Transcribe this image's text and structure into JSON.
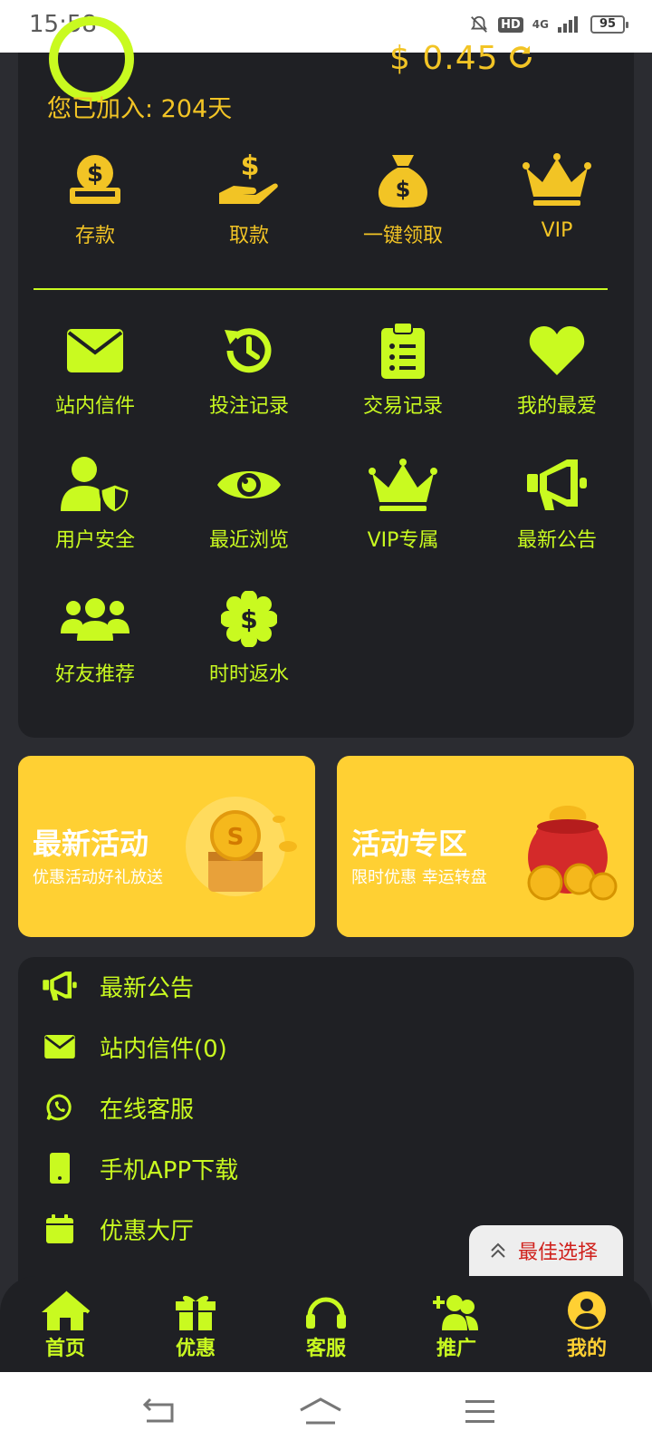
{
  "status_bar": {
    "time": "15:58",
    "hd": "HD",
    "network": "4G",
    "battery": "95"
  },
  "account": {
    "balance": "$ 0.45",
    "joined_text": "您已加入: 204天"
  },
  "quick_actions": [
    {
      "label": "存款",
      "icon": "deposit-icon"
    },
    {
      "label": "取款",
      "icon": "withdraw-icon"
    },
    {
      "label": "一键领取",
      "icon": "money-bag-icon"
    },
    {
      "label": "VIP",
      "icon": "crown-icon"
    }
  ],
  "features": [
    {
      "label": "站内信件",
      "icon": "mail-icon"
    },
    {
      "label": "投注记录",
      "icon": "history-icon"
    },
    {
      "label": "交易记录",
      "icon": "clipboard-icon"
    },
    {
      "label": "我的最爱",
      "icon": "heart-icon"
    },
    {
      "label": "用户安全",
      "icon": "user-shield-icon"
    },
    {
      "label": "最近浏览",
      "icon": "eye-icon"
    },
    {
      "label": "VIP专属",
      "icon": "crown-icon"
    },
    {
      "label": "最新公告",
      "icon": "megaphone-icon"
    },
    {
      "label": "好友推荐",
      "icon": "users-icon"
    },
    {
      "label": "时时返水",
      "icon": "rebate-icon"
    }
  ],
  "promos": [
    {
      "title": "最新活动",
      "subtitle": "优惠活动好礼放送"
    },
    {
      "title": "活动专区",
      "subtitle": "限时优惠 幸运转盘"
    }
  ],
  "menu": [
    {
      "label": "最新公告",
      "icon": "megaphone-icon"
    },
    {
      "label": "站内信件(0)",
      "icon": "mail-icon"
    },
    {
      "label": "在线客服",
      "icon": "whatsapp-icon"
    },
    {
      "label": "手机APP下载",
      "icon": "phone-icon"
    },
    {
      "label": "优惠大厅",
      "icon": "calendar-icon"
    }
  ],
  "floating": {
    "best_choice": "最佳选择"
  },
  "bottom_nav": [
    {
      "label": "首页",
      "icon": "home-icon"
    },
    {
      "label": "优惠",
      "icon": "gift-icon"
    },
    {
      "label": "客服",
      "icon": "headset-icon"
    },
    {
      "label": "推广",
      "icon": "user-plus-icon"
    },
    {
      "label": "我的",
      "icon": "user-circle-icon",
      "active": true
    }
  ],
  "colors": {
    "accent_green": "#c9fa20",
    "accent_yellow": "#f2c425",
    "card_bg": "#1f2024",
    "page_bg": "#2b2c31"
  }
}
